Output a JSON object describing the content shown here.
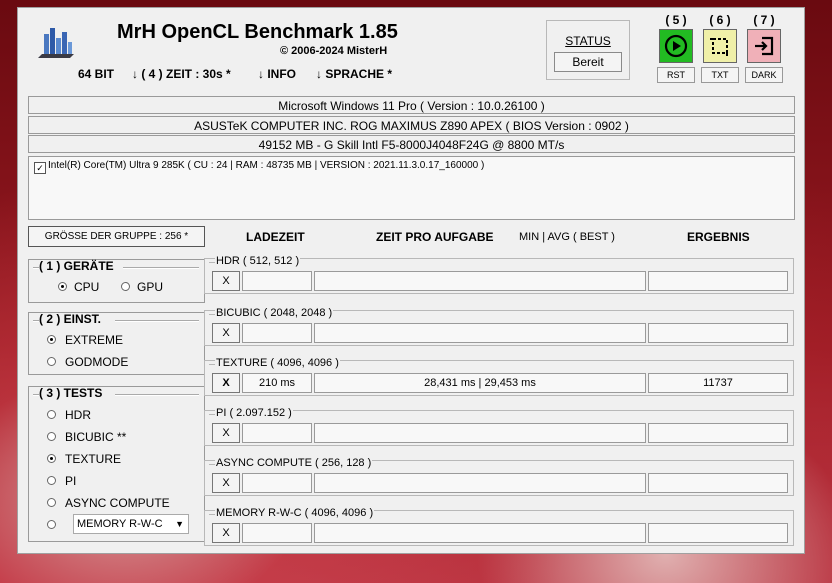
{
  "header": {
    "title": "MrH OpenCL Benchmark 1.85",
    "copyright": "©  2006-2024 MisterH"
  },
  "menu": {
    "bits": "64 BIT",
    "zeit": "↓ ( 4 ) ZEIT : 30s *",
    "info": "↓ INFO",
    "sprache": "↓ SPRACHE *"
  },
  "status": {
    "label": "STATUS",
    "value": "Bereit"
  },
  "actions": [
    {
      "number": "( 5 )",
      "label": "RST",
      "icon": "play-icon",
      "color": "#22bb22"
    },
    {
      "number": "( 6 )",
      "label": "TXT",
      "icon": "crop-select-icon",
      "color": "#f0f0a8"
    },
    {
      "number": "( 7 )",
      "label": "DARK",
      "icon": "exit-icon",
      "color": "#f0b0b8"
    }
  ],
  "system": {
    "os": "Microsoft Windows 11 Pro ( Version : 10.0.26100 )",
    "board": "ASUSTeK COMPUTER INC. ROG MAXIMUS Z890 APEX ( BIOS Version : 0902 )",
    "memory": "49152 MB - G Skill Intl F5-8000J4048F24G    @ 8800 MT/s"
  },
  "device": {
    "checked": "✓",
    "text": "Intel(R) Core(TM) Ultra 9 285K ( CU : 24 | RAM : 48735 MB | VERSION : 2021.11.3.0.17_160000 )"
  },
  "group_size": "GRÖSSE DER GRUPPE : 256 *",
  "columns": {
    "ladezeit": "LADEZEIT",
    "zeit": "ZEIT PRO AUFGABE",
    "minavg": "MIN | AVG ( BEST )",
    "ergebnis": "ERGEBNIS"
  },
  "geraete": {
    "title": "( 1 ) GERÄTE",
    "cpu": "CPU",
    "gpu": "GPU",
    "selected": "CPU"
  },
  "einst": {
    "title": "( 2 ) EINST.",
    "extreme": "EXTREME",
    "godmode": "GODMODE",
    "selected": "EXTREME"
  },
  "tests_panel": {
    "title": "( 3 ) TESTS",
    "hdr": "HDR",
    "bicubic": "BICUBIC **",
    "texture": "TEXTURE",
    "pi": "PI",
    "async": "ASYNC COMPUTE",
    "memory_select": "MEMORY R-W-C",
    "selected": "TEXTURE"
  },
  "tests": [
    {
      "name": "HDR ( 512, 512 )",
      "x": "X",
      "ladezeit": "",
      "zeit": "",
      "ergebnis": ""
    },
    {
      "name": "BICUBIC ( 2048, 2048 )",
      "x": "X",
      "ladezeit": "",
      "zeit": "",
      "ergebnis": ""
    },
    {
      "name": "TEXTURE ( 4096, 4096 )",
      "x": "X",
      "ladezeit": "210 ms",
      "zeit": "28,431 ms | 29,453 ms",
      "ergebnis": "11737"
    },
    {
      "name": "PI ( 2.097.152 )",
      "x": "X",
      "ladezeit": "",
      "zeit": "",
      "ergebnis": ""
    },
    {
      "name": "ASYNC COMPUTE ( 256, 128 )",
      "x": "X",
      "ladezeit": "",
      "zeit": "",
      "ergebnis": ""
    },
    {
      "name": "MEMORY R-W-C ( 4096, 4096 )",
      "x": "X",
      "ladezeit": "",
      "zeit": "",
      "ergebnis": ""
    }
  ]
}
